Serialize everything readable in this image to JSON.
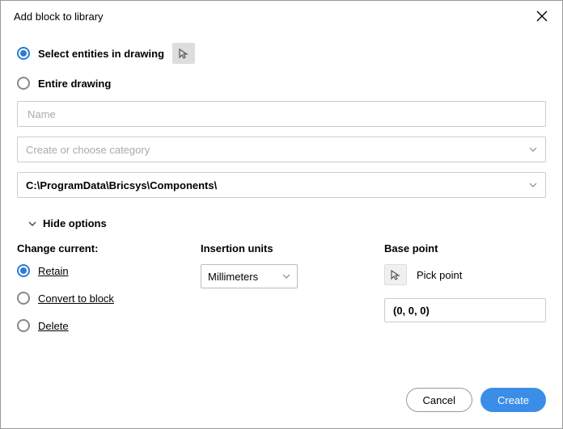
{
  "title": "Add block to library",
  "selectionMode": {
    "selectEntities": "Select entities in drawing",
    "entireDrawing": "Entire drawing"
  },
  "name_placeholder": "Name",
  "category_placeholder": "Create or choose category",
  "path": "C:\\ProgramData\\Bricsys\\Components\\",
  "toggle_label": "Hide options",
  "columns": {
    "changeCurrent": {
      "heading": "Change current:",
      "retain": "Retain",
      "convert": "Convert to block",
      "delete": "Delete"
    },
    "insertionUnits": {
      "heading": "Insertion units",
      "value": "Millimeters"
    },
    "basePoint": {
      "heading": "Base point",
      "pick": "Pick point",
      "value": "(0, 0, 0)"
    }
  },
  "buttons": {
    "cancel": "Cancel",
    "create": "Create"
  }
}
